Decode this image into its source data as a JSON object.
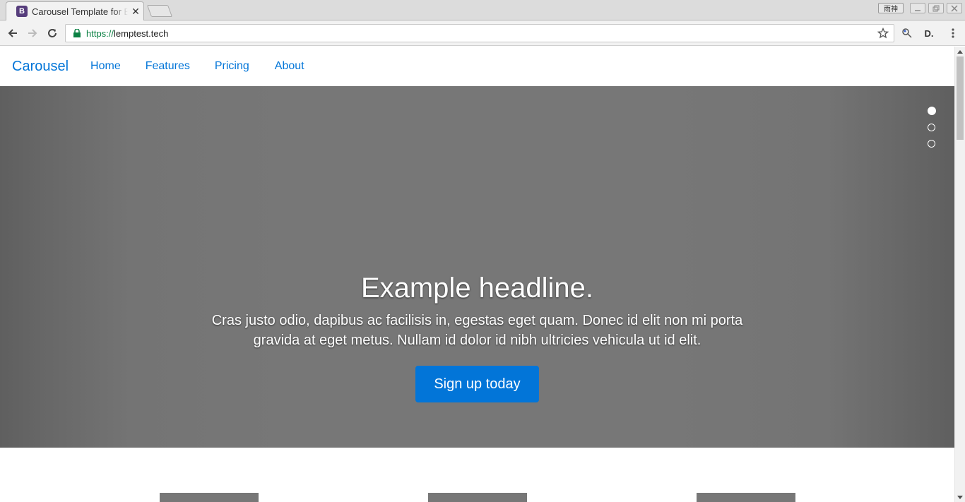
{
  "browser": {
    "tab_title": "Carousel Template for Bootstrap",
    "tab_favicon_letter": "B",
    "tab_close": "✕",
    "ime_label": "雨神",
    "url_scheme": "https://",
    "url_host": "lemptest.tech",
    "extension_label": "D."
  },
  "navbar": {
    "brand": "Carousel",
    "links": [
      "Home",
      "Features",
      "Pricing",
      "About"
    ]
  },
  "carousel": {
    "active_slide": 1,
    "slide_count": 3,
    "headline": "Example headline.",
    "lead": "Cras justo odio, dapibus ac facilisis in, egestas eget quam. Donec id elit non mi porta gravida at eget metus. Nullam id dolor id nibh ultricies vehicula ut id elit.",
    "button_label": "Sign up today"
  },
  "colors": {
    "link": "#0275d8",
    "carousel_bg": "#777777",
    "button_bg": "#0275d8"
  }
}
